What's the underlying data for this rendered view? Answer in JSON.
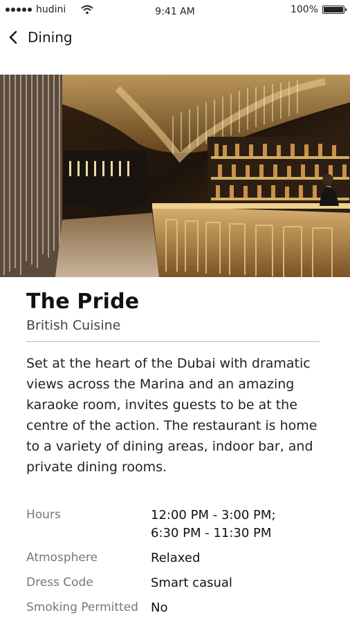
{
  "status": {
    "carrier": "hudini",
    "time": "9:41 AM",
    "battery": "100%",
    "battery_level": 1.0
  },
  "nav": {
    "back_label": "Dining"
  },
  "gallery": {
    "page_count": 5,
    "active_index": 3
  },
  "restaurant": {
    "name": "The Pride",
    "cuisine": "British Cuisine",
    "description": "Set at the heart of the Dubai with dramatic views across the Marina and an amazing karaoke room, invites guests to be at the centre of the action. The restaurant is home to a variety of dining areas, indoor bar, and private dining rooms."
  },
  "details": {
    "hours_label": "Hours",
    "hours_value_1": "12:00 PM - 3:00 PM;",
    "hours_value_2": "6:30 PM - 11:30 PM",
    "atmosphere_label": "Atmosphere",
    "atmosphere_value": "Relaxed",
    "dress_label": "Dress Code",
    "dress_value": "Smart casual",
    "smoking_label": "Smoking Permitted",
    "smoking_value": "No"
  }
}
